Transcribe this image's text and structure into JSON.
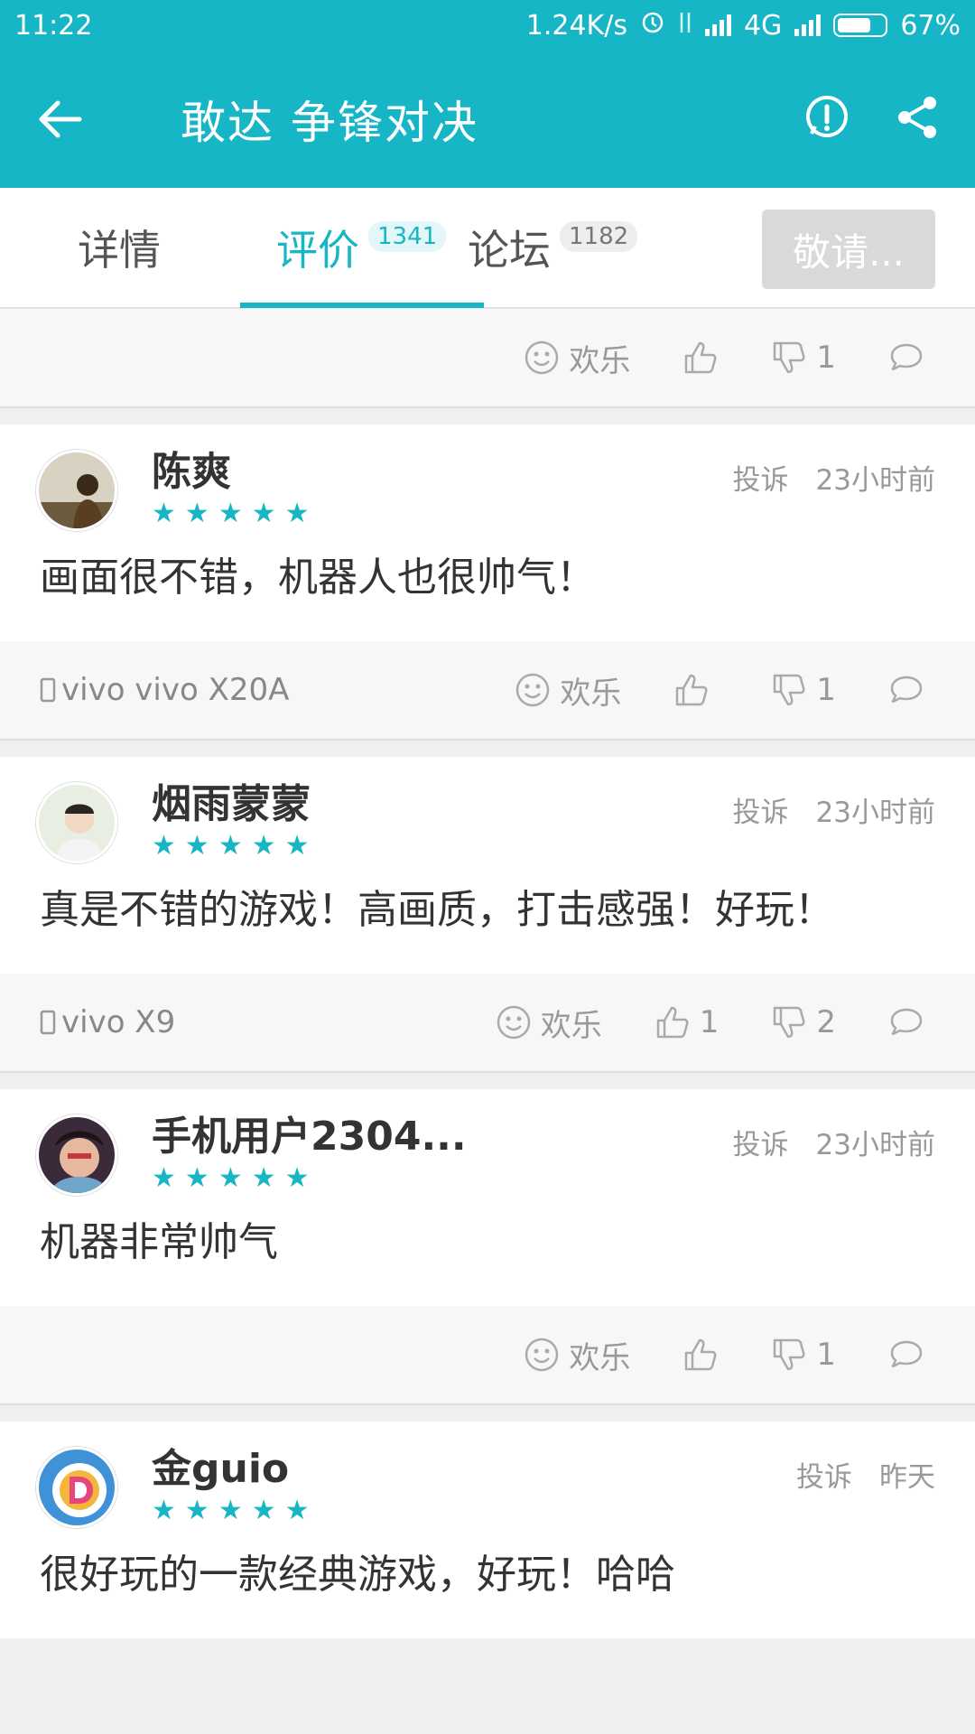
{
  "status_bar": {
    "time": "11:22",
    "speed": "1.24K/s",
    "network": "4G",
    "battery": "67%"
  },
  "app_bar": {
    "title": "敢达 争锋对决"
  },
  "tabs": [
    {
      "label": "详情"
    },
    {
      "label": "评价",
      "badge": "1341"
    },
    {
      "label": "论坛",
      "badge": "1182"
    }
  ],
  "follow_button": {
    "label": "敬请..."
  },
  "top_footer": {
    "emotion": "欢乐",
    "dislikes": "1"
  },
  "reviews": [
    {
      "name": "陈爽",
      "report": "投诉",
      "time": "23小时前",
      "text": "画面很不错，机器人也很帅气！",
      "device": "vivo vivo X20A",
      "emotion": "欢乐",
      "likes": "",
      "dislikes": "1"
    },
    {
      "name": "烟雨蒙蒙",
      "report": "投诉",
      "time": "23小时前",
      "text": "真是不错的游戏！高画质，打击感强！好玩！",
      "device": "vivo X9",
      "emotion": "欢乐",
      "likes": "1",
      "dislikes": "2"
    },
    {
      "name": "手机用户2304...",
      "report": "投诉",
      "time": "23小时前",
      "text": "机器非常帅气",
      "device": "",
      "emotion": "欢乐",
      "likes": "",
      "dislikes": "1"
    },
    {
      "name": "金guio",
      "report": "投诉",
      "time": "昨天",
      "text": "很好玩的一款经典游戏，好玩！哈哈"
    }
  ],
  "colors": {
    "accent": "#17b6c6",
    "star": "#17b6c6"
  }
}
